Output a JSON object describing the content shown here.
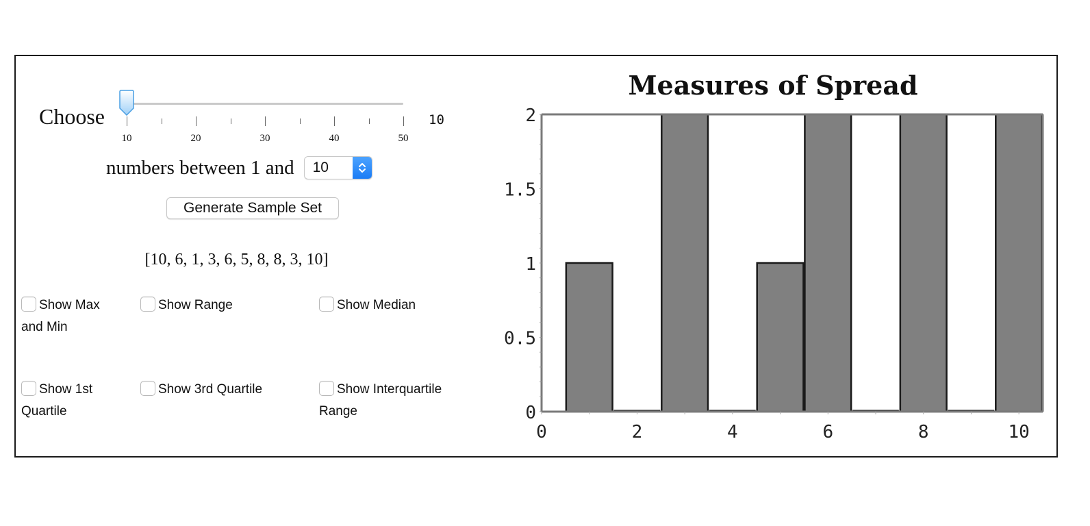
{
  "controls": {
    "choose_label": "Choose",
    "slider": {
      "min": 10,
      "max": 50,
      "value": 10,
      "tick_labels": [
        "10",
        "20",
        "30",
        "40",
        "50"
      ],
      "value_display": "10"
    },
    "between_label": "numbers between 1 and",
    "upper_bound_select": {
      "value": "10"
    },
    "generate_button_label": "Generate Sample Set",
    "sample_set_text": "[10, 6, 1, 3, 6, 5, 8, 8, 3, 10]",
    "checkboxes": [
      {
        "label_line1": "Show Max",
        "label_line2": "and Min",
        "checked": false
      },
      {
        "label_line1": "Show Range",
        "label_line2": "",
        "checked": false
      },
      {
        "label_line1": "Show Median",
        "label_line2": "",
        "checked": false
      },
      {
        "label_line1": "Show 1st",
        "label_line2": "Quartile",
        "checked": false
      },
      {
        "label_line1": "Show 3rd Quartile",
        "label_line2": "",
        "checked": false
      },
      {
        "label_line1": "Show Interquartile",
        "label_line2": "Range",
        "checked": false
      }
    ]
  },
  "colors": {
    "bar_fill": "#808080",
    "bar_stroke": "#1a1a1a",
    "axis": "#7a7a7a",
    "slider_thumb": "#5aaef0",
    "select_accent": "#1a7cf5"
  },
  "chart_data": {
    "type": "bar",
    "title": "Measures of Spread",
    "xlabel": "",
    "ylabel": "",
    "categories": [
      1,
      2,
      3,
      4,
      5,
      6,
      7,
      8,
      9,
      10
    ],
    "values": [
      1,
      0,
      2,
      0,
      1,
      2,
      0,
      2,
      0,
      2
    ],
    "xlim": [
      0,
      10.5
    ],
    "ylim": [
      0,
      2
    ],
    "x_ticks": [
      "0",
      "2",
      "4",
      "6",
      "8",
      "10"
    ],
    "y_ticks": [
      "0",
      "0.5",
      "1",
      "1.5",
      "2"
    ],
    "grid": false,
    "legend": "none"
  }
}
